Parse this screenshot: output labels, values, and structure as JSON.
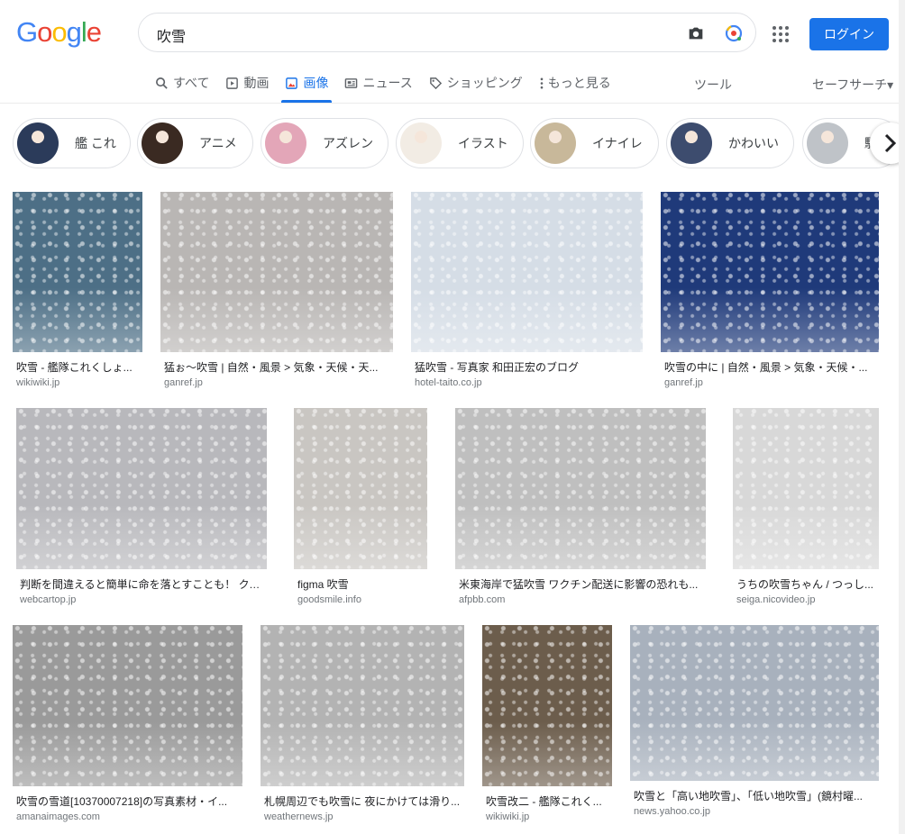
{
  "logo": "Google",
  "search": {
    "query": "吹雪"
  },
  "login_label": "ログイン",
  "tabs": [
    {
      "label": "すべて",
      "icon": "search-icon"
    },
    {
      "label": "動画",
      "icon": "video-icon"
    },
    {
      "label": "画像",
      "icon": "image-icon"
    },
    {
      "label": "ニュース",
      "icon": "news-icon"
    },
    {
      "label": "ショッピング",
      "icon": "tag-icon"
    },
    {
      "label": "もっと見る",
      "icon": "more-vert-icon"
    }
  ],
  "tools_label": "ツール",
  "safesearch_label": "セーフサーチ▾",
  "chips": [
    {
      "label": "艦 これ",
      "color": "#2b3b5a"
    },
    {
      "label": "アニメ",
      "color": "#3a2a22"
    },
    {
      "label": "アズレン",
      "color": "#e3a6b8"
    },
    {
      "label": "イラスト",
      "color": "#f2ece4"
    },
    {
      "label": "イナイレ",
      "color": "#c8b89a"
    },
    {
      "label": "かわいい",
      "color": "#3d4c6e"
    },
    {
      "label": "駆",
      "color": "#bfc3c8"
    }
  ],
  "results": [
    {
      "title": "吹雪 - 艦隊これくしょ...",
      "source": "wikiwiki.jp",
      "color": "#4d6f86"
    },
    {
      "title": "猛ぉ〜吹雪 | 自然・風景 > 気象・天候・天...",
      "source": "ganref.jp",
      "color": "#b9b6b4"
    },
    {
      "title": "猛吹雪 - 写真家 和田正宏のブログ",
      "source": "hotel-taito.co.jp",
      "color": "#d5dde6"
    },
    {
      "title": "吹雪の中に | 自然・風景 > 気象・天候・...",
      "source": "ganref.jp",
      "color": "#1f3a7a"
    },
    {
      "title": "判断を間違えると簡単に命を落とすことも！ クル...",
      "source": "webcartop.jp",
      "color": "#b8b8bc"
    },
    {
      "title": "figma 吹雪",
      "source": "goodsmile.info",
      "color": "#c9c6c2"
    },
    {
      "title": "米東海岸で猛吹雪 ワクチン配送に影響の恐れも...",
      "source": "afpbb.com",
      "color": "#bfbfbf"
    },
    {
      "title": "うちの吹雪ちゃん / つっし...",
      "source": "seiga.nicovideo.jp",
      "color": "#d8d8d8"
    },
    {
      "title": "吹雪の雪道[10370007218]の写真素材・イ...",
      "source": "amanaimages.com",
      "color": "#9a9a9a"
    },
    {
      "title": "札幌周辺でも吹雪に 夜にかけては滑り...",
      "source": "weathernews.jp",
      "color": "#b3b3b3"
    },
    {
      "title": "吹雪改二 - 艦隊これく...",
      "source": "wikiwiki.jp",
      "color": "#6c5d4c"
    },
    {
      "title": "吹雪と「高い地吹雪」、「低い地吹雪」(鏡村曜...",
      "source": "news.yahoo.co.jp",
      "color": "#a8b1bd"
    }
  ]
}
